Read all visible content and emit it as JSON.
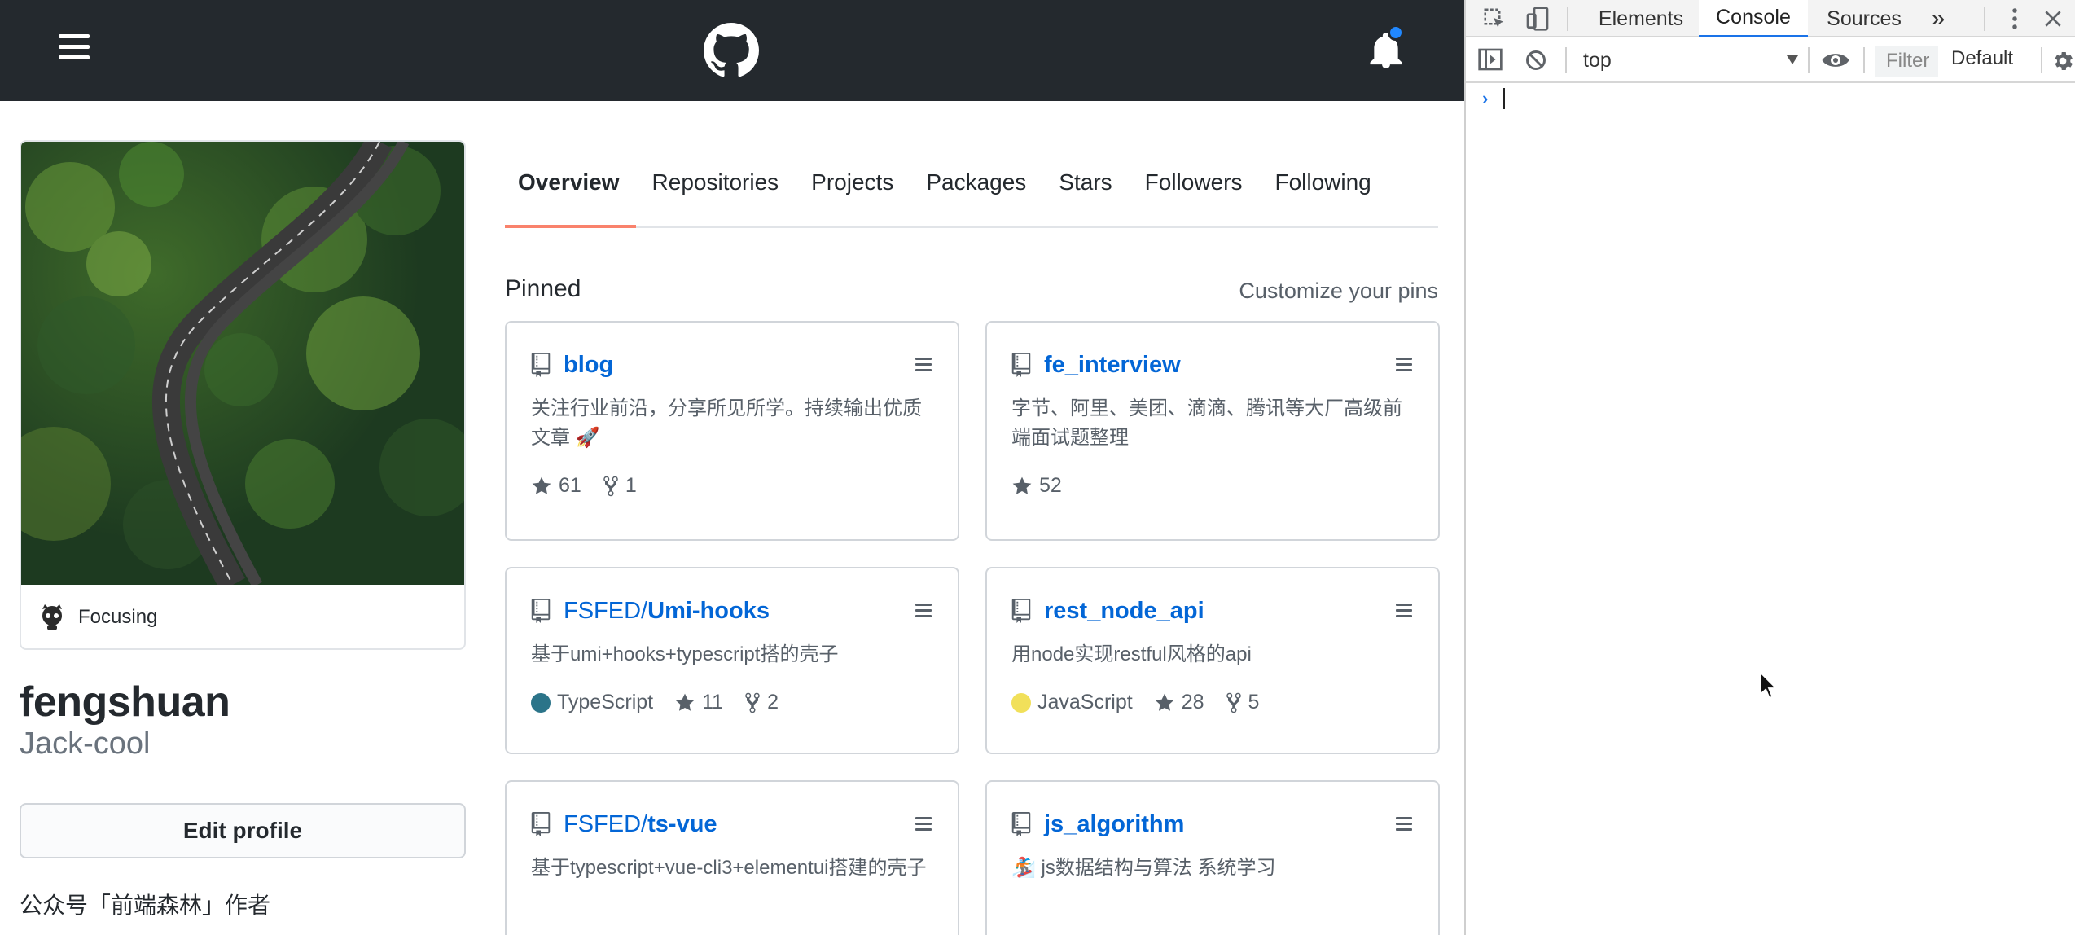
{
  "profile": {
    "status": "Focusing",
    "name": "fengshuan",
    "login": "Jack-cool",
    "edit_label": "Edit profile",
    "bio": "公众号「前端森林」作者"
  },
  "tabs": [
    "Overview",
    "Repositories",
    "Projects",
    "Packages",
    "Stars",
    "Followers",
    "Following"
  ],
  "active_tab": "Overview",
  "pinned": {
    "title": "Pinned",
    "customize": "Customize your pins",
    "cards": [
      {
        "owner": "",
        "name": "blog",
        "desc": "关注行业前沿，分享所见所学。持续输出优质文章 🚀",
        "language": "",
        "lang_color": "",
        "stars": "61",
        "forks": "1"
      },
      {
        "owner": "",
        "name": "fe_interview",
        "desc": "字节、阿里、美团、滴滴、腾讯等大厂高级前端面试题整理",
        "language": "",
        "lang_color": "",
        "stars": "52",
        "forks": ""
      },
      {
        "owner": "FSFED/",
        "name": "Umi-hooks",
        "desc": "基于umi+hooks+typescript搭的壳子",
        "language": "TypeScript",
        "lang_color": "#2b7489",
        "stars": "11",
        "forks": "2"
      },
      {
        "owner": "",
        "name": "rest_node_api",
        "desc": "用node实现restful风格的api",
        "language": "JavaScript",
        "lang_color": "#f1e05a",
        "stars": "28",
        "forks": "5"
      },
      {
        "owner": "FSFED/",
        "name": "ts-vue",
        "desc": "基于typescript+vue-cli3+elementui搭建的壳子",
        "language": "",
        "lang_color": "",
        "stars": "",
        "forks": ""
      },
      {
        "owner": "",
        "name": "js_algorithm",
        "desc": "🏂 js数据结构与算法 系统学习",
        "language": "",
        "lang_color": "",
        "stars": "",
        "forks": ""
      }
    ]
  },
  "devtools": {
    "tabs": [
      "Elements",
      "Console",
      "Sources"
    ],
    "active_tab": "Console",
    "more": "»",
    "context": "top",
    "filter_placeholder": "Filter",
    "levels": "Default",
    "prompt": "›"
  },
  "colors": {
    "header_bg": "#24292e",
    "link": "#0366d6",
    "tab_underline": "#f9826c",
    "devtools_accent": "#1a73e8"
  },
  "icons": [
    "hamburger-icon",
    "github-logo-icon",
    "bell-icon",
    "repo-icon",
    "kebab-icon",
    "star-icon",
    "fork-icon",
    "inspect-icon",
    "device-icon",
    "sidebar-icon",
    "clear-icon",
    "eye-icon",
    "gear-icon",
    "close-icon",
    "more-vert-icon"
  ]
}
